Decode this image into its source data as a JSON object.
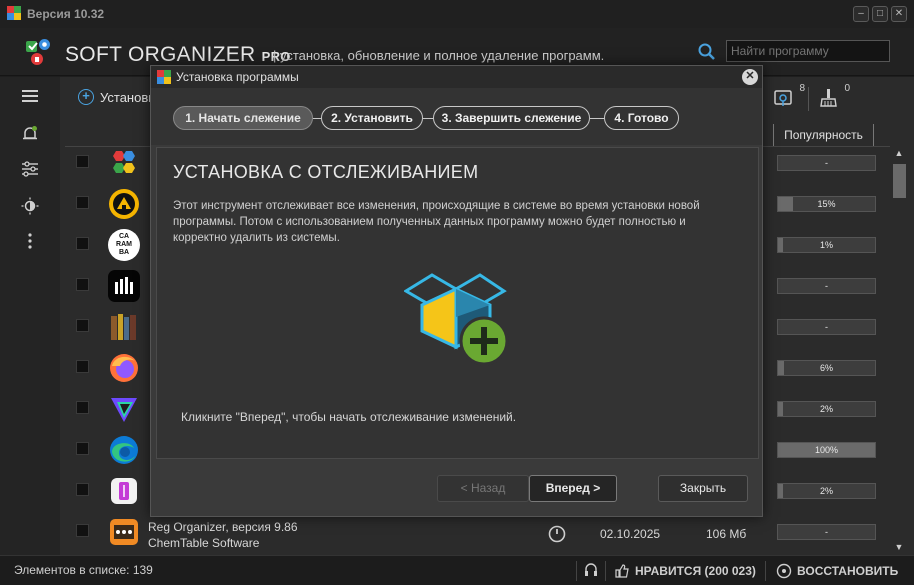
{
  "window": {
    "version": "Версия 10.32",
    "controls": [
      "minimize-icon",
      "maximize-icon",
      "close-icon"
    ]
  },
  "header": {
    "brand": "SOFT ORGANIZER",
    "brand_suffix": "PRO",
    "tagline": "| установка, обновление и полное удаление программ.",
    "search_placeholder": "Найти программу"
  },
  "sidebar": {
    "icons": [
      "menu-icon",
      "notifications-icon",
      "settings-sliders-icon",
      "theme-icon",
      "more-icon"
    ]
  },
  "toolbar": {
    "install_label": "Установи",
    "tray_badge": "8",
    "cleanup_badge": "0"
  },
  "list": {
    "popularity_header": "Популярность",
    "rows": [
      {
        "icon": "multicolor-hexagons-icon",
        "popularity": "-",
        "fill": 0
      },
      {
        "icon": "aimp-icon",
        "popularity": "15%",
        "fill": 0.15
      },
      {
        "icon": "caramba-icon",
        "popularity": "1%",
        "fill": 0.01
      },
      {
        "icon": "audio-bars-icon",
        "popularity": "-",
        "fill": 0
      },
      {
        "icon": "books-icon",
        "popularity": "-",
        "fill": 0
      },
      {
        "icon": "firefox-icon",
        "popularity": "6%",
        "fill": 0.06
      },
      {
        "icon": "proton-vpn-icon",
        "popularity": "2%",
        "fill": 0.02
      },
      {
        "icon": "edge-icon",
        "popularity": "100%",
        "fill": 1.0
      },
      {
        "icon": "usb-flash-icon",
        "popularity": "2%",
        "fill": 0.02
      },
      {
        "icon": "reg-organizer-icon",
        "popularity": "-",
        "fill": 0
      }
    ],
    "last_item": {
      "name": "Reg Organizer, версия 9.86",
      "publisher": "ChemTable Software",
      "date": "02.10.2025",
      "size": "106 Мб"
    }
  },
  "status": {
    "count": "Элементов в списке: 139",
    "like": "НРАВИТСЯ (200 023)",
    "restore": "ВОССТАНОВИТЬ"
  },
  "dialog": {
    "title": "Установка программы",
    "steps": [
      "1. Начать слежение",
      "2. Установить",
      "3. Завершить слежение",
      "4. Готово"
    ],
    "active_step": 0,
    "heading": "УСТАНОВКА С ОТСЛЕЖИВАНИЕМ",
    "description": "Этот инструмент отслеживает все изменения, происходящие в системе во время установки новой программы. Потом с использованием полученных данных программу можно будет полностью и корректно удалить из системы.",
    "hint": "Кликните \"Вперед\", чтобы начать отслеживание изменений.",
    "buttons": {
      "back": "< Назад",
      "next": "Вперед >",
      "close": "Закрыть"
    }
  },
  "colors": {
    "accent_blue": "#4aa3e0",
    "box_yellow": "#f5c518",
    "plus_green": "#6aa832"
  }
}
